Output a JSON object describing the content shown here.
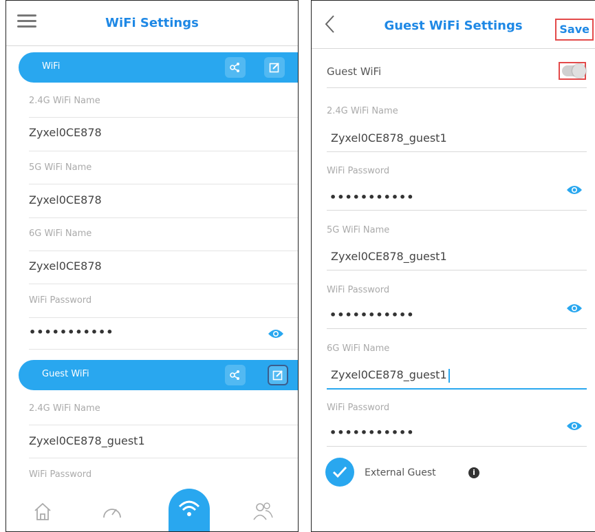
{
  "left": {
    "title": "WiFi Settings",
    "wifi_section": {
      "label": "WiFi",
      "fields": [
        {
          "label": "2.4G WiFi Name",
          "value": "Zyxel0CE878"
        },
        {
          "label": "5G WiFi Name",
          "value": "Zyxel0CE878"
        },
        {
          "label": "6G WiFi Name",
          "value": "Zyxel0CE878"
        },
        {
          "label": "WiFi Password",
          "value": "•••••••••••"
        }
      ]
    },
    "guest_section": {
      "label": "Guest WiFi",
      "fields": [
        {
          "label": "2.4G WiFi Name",
          "value": "Zyxel0CE878_guest1"
        },
        {
          "label": "WiFi Password",
          "value": ""
        }
      ]
    },
    "bottom_nav": [
      {
        "icon": "home-icon"
      },
      {
        "icon": "speedometer-icon"
      },
      {
        "icon": "wifi-icon",
        "active": true
      },
      {
        "icon": "users-icon"
      }
    ]
  },
  "right": {
    "title": "Guest WiFi Settings",
    "save_label": "Save",
    "guest_wifi_label": "Guest WiFi",
    "guest_wifi_enabled": false,
    "fields": [
      {
        "label": "2.4G WiFi Name",
        "value": "Zyxel0CE878_guest1"
      },
      {
        "label": "WiFi Password",
        "value": "•••••••••••"
      },
      {
        "label": "5G WiFi Name",
        "value": "Zyxel0CE878_guest1"
      },
      {
        "label": "WiFi Password",
        "value": "•••••••••••"
      },
      {
        "label": "6G WiFi Name",
        "value": "Zyxel0CE878_guest1"
      },
      {
        "label": "WiFi Password",
        "value": "•••••••••••"
      }
    ],
    "external_guest_label": "External Guest",
    "external_guest_checked": true,
    "info_glyph": "i"
  },
  "colors": {
    "accent": "#29a7ef",
    "title": "#1e88e5",
    "highlight": "#e34949"
  }
}
